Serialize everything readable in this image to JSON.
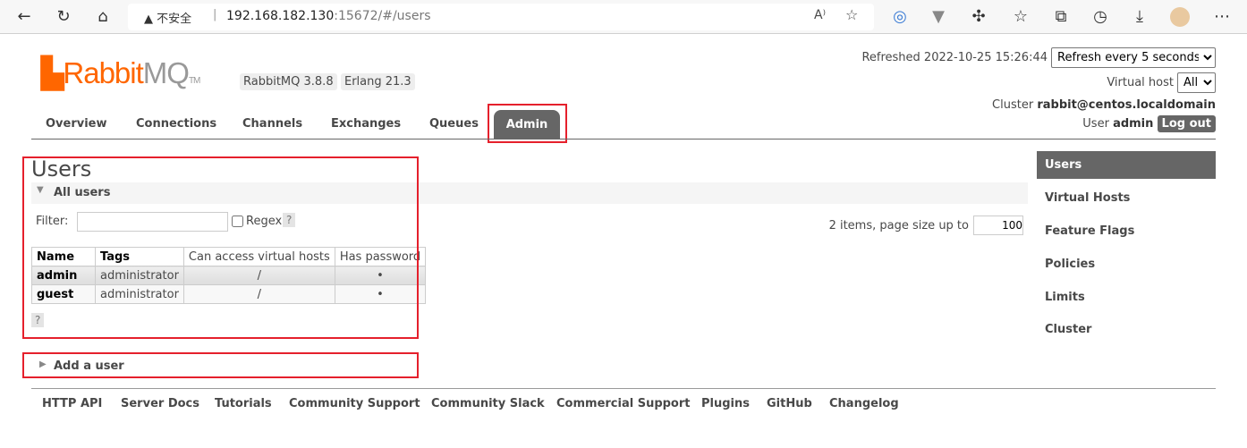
{
  "browser": {
    "security_label": "不安全",
    "url_host": "192.168.182.130",
    "url_rest": ":15672/#/users",
    "icons": [
      "back-icon",
      "refresh-icon",
      "home-icon",
      "read-aloud-icon",
      "add-favorite-icon",
      "extension-icon",
      "vue-icon",
      "extensions-icon",
      "favorites-icon",
      "collections-icon",
      "history-icon",
      "download-icon",
      "profile-avatar",
      "more-icon"
    ]
  },
  "header": {
    "logo_main": "Rabbit",
    "logo_mq": "MQ",
    "logo_tm": "TM",
    "version": "RabbitMQ 3.8.8",
    "erlang": "Erlang 21.3",
    "refreshed": "Refreshed 2022-10-25 15:26:44",
    "refresh_option": "Refresh every 5 seconds",
    "vhost_label": "Virtual host",
    "vhost_option": "All",
    "cluster_label": "Cluster",
    "cluster_name": "rabbit@centos.localdomain",
    "user_label": "User",
    "user_name": "admin",
    "logout": "Log out"
  },
  "tabs": [
    "Overview",
    "Connections",
    "Channels",
    "Exchanges",
    "Queues",
    "Admin"
  ],
  "main": {
    "title": "Users",
    "all_users": "All users",
    "filter_label": "Filter:",
    "filter_value": "",
    "regex_label": "Regex",
    "help": "?",
    "pagination": "2 items, page size up to",
    "page_size": "100",
    "columns": [
      "Name",
      "Tags",
      "Can access virtual hosts",
      "Has password"
    ],
    "rows": [
      [
        "admin",
        "administrator",
        "/",
        "•"
      ],
      [
        "guest",
        "administrator",
        "/",
        "•"
      ]
    ],
    "add_user": "Add a user"
  },
  "sidebar": [
    "Users",
    "Virtual Hosts",
    "Feature Flags",
    "Policies",
    "Limits",
    "Cluster"
  ],
  "footer": [
    "HTTP API",
    "Server Docs",
    "Tutorials",
    "Community Support",
    "Community Slack",
    "Commercial Support",
    "Plugins",
    "GitHub",
    "Changelog"
  ],
  "colors": {
    "brand": "#ff6600",
    "active_tab": "#666666",
    "highlight_box": "#e5202c"
  }
}
